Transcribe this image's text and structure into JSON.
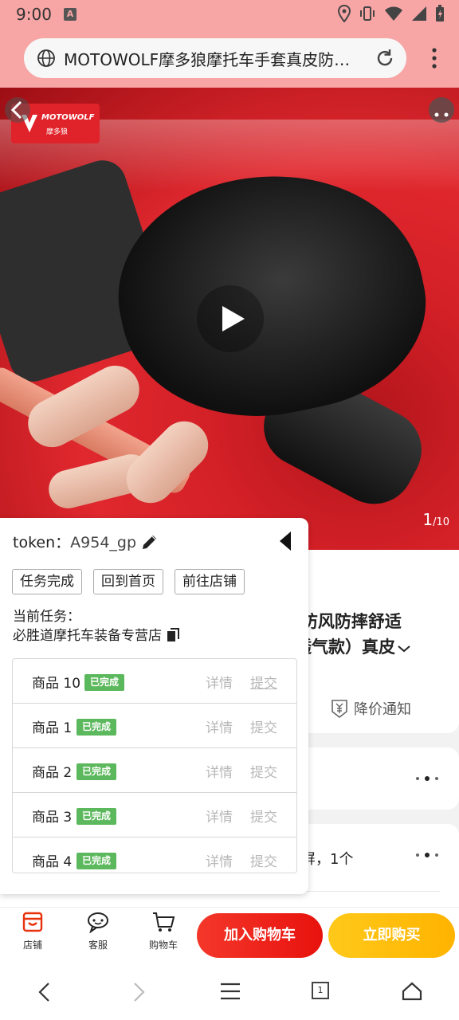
{
  "status_bar": {
    "time": "9:00",
    "notif_badge": "A"
  },
  "browser": {
    "url_title": "MOTOWOLF摩多狼摩托车手套真皮防…"
  },
  "hero": {
    "logo_brand": "MOTOWOLF",
    "logo_cn": "摩多狼",
    "counter_current": "1",
    "counter_total": "/10"
  },
  "product": {
    "title_line1": "I防风防摔舒适",
    "title_line2": "透气款）真皮",
    "price_notify": "降价通知",
    "spec_fragment": "屏，1个"
  },
  "panel": {
    "token_label": "token：",
    "token_value": "A954_gp",
    "buttons": [
      "任务完成",
      "回到首页",
      "前往店铺"
    ],
    "current_task_label": "当前任务：",
    "current_task_value": "必胜道摩托车装备专营店",
    "rows": [
      {
        "name": "商品 10",
        "badge": "已完成",
        "detail": "详情",
        "submit": "提交"
      },
      {
        "name": "商品 1",
        "badge": "已完成",
        "detail": "详情",
        "submit": "提交"
      },
      {
        "name": "商品 2",
        "badge": "已完成",
        "detail": "详情",
        "submit": "提交"
      },
      {
        "name": "商品 3",
        "badge": "已完成",
        "detail": "详情",
        "submit": "提交"
      },
      {
        "name": "商品 4",
        "badge": "已完成",
        "detail": "详情",
        "submit": "提交"
      }
    ]
  },
  "actionbar": {
    "shop": "店铺",
    "service": "客服",
    "cart": "购物车",
    "add_to_cart": "加入购物车",
    "buy_now": "立即购买"
  },
  "navbar": {
    "tab_count": "1"
  },
  "colors": {
    "browser_bar": "#f7a5a5",
    "badge_green": "#5cb85c",
    "add_cart_red": "#f4372a",
    "buy_yellow": "#ffc91a"
  }
}
